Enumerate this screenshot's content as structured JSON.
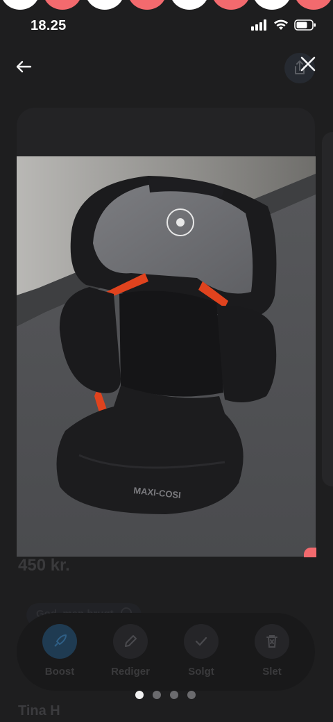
{
  "status_bar": {
    "time": "18.25"
  },
  "listing": {
    "price": "450 kr.",
    "condition": "God, men brugt",
    "seller": "Tina H",
    "photo": {
      "brand_text": "MAXI-COSI",
      "headrest_logo_text": "MAXI-COSI"
    }
  },
  "actions": [
    {
      "label": "Boost",
      "icon": "rocket-icon"
    },
    {
      "label": "Rediger",
      "icon": "pencil-icon"
    },
    {
      "label": "Solgt",
      "icon": "check-icon"
    },
    {
      "label": "Slet",
      "icon": "trash-icon"
    }
  ],
  "carousel": {
    "count": 4,
    "active": 1
  },
  "colors": {
    "accent": "#f36a6e",
    "boost": "#1f3b52",
    "background": "#1e1e1f"
  }
}
